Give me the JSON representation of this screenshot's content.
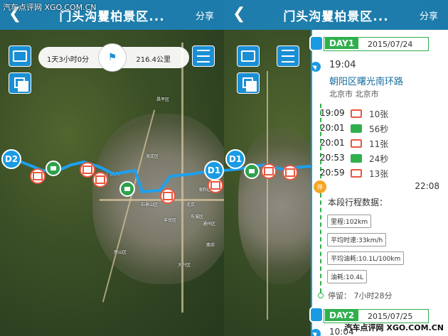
{
  "watermark": {
    "top_left": "汽车点评网  XGO.COM.CN",
    "bottom_right": "汽车点评网  XGO.COM.CN"
  },
  "left": {
    "title": "门头沟矍柏景区...",
    "share": "分享",
    "trip_duration": "1天3小时0分",
    "trip_distance": "216.4公里",
    "markers": {
      "start": "D1",
      "end": "D2"
    },
    "map_labels": [
      "北京",
      "石景山区",
      "海淀区",
      "昌平区",
      "丰台区",
      "通州区",
      "门头沟",
      "大兴区",
      "朝阳区",
      "东城区",
      "燕郊",
      "房山区"
    ]
  },
  "right": {
    "title": "门头沟矍柏景区...",
    "share": "分享",
    "marker": "D1",
    "day1": {
      "badge": "DAY1",
      "date": "2015/07/24"
    },
    "start_time": "19:04",
    "start_place": "朝阳区曙光南环路",
    "start_city": "北京市 北京市",
    "events": [
      {
        "time": "19:09",
        "type": "photo",
        "value": "10张"
      },
      {
        "time": "20:01",
        "type": "video",
        "value": "56秒"
      },
      {
        "time": "20:01",
        "type": "photo",
        "value": "11张"
      },
      {
        "time": "20:53",
        "type": "video",
        "value": "24秒"
      },
      {
        "time": "20:59",
        "type": "photo",
        "value": "13张"
      }
    ],
    "stop_time": "22:08",
    "stop_badge": "停",
    "stats_title": "本段行程数据：",
    "stats": [
      "里程:102km",
      "平均时速:33km/h",
      "平均油耗:10.1L/100km",
      "油耗:10.4L"
    ],
    "stop_duration": "停留： 7小时28分",
    "day2": {
      "badge": "DAY2",
      "date": "2015/07/25"
    },
    "next_time": "10:04"
  },
  "colors": {
    "accent": "#1a9ae3",
    "green": "#2fb04d",
    "photo": "#e8573f",
    "stop": "#f5a623"
  },
  "icons": [
    "back-icon",
    "photo-icon",
    "layers-icon",
    "menu-icon",
    "route-icon",
    "car-icon",
    "navigation-icon",
    "camera-icon",
    "video-icon"
  ]
}
